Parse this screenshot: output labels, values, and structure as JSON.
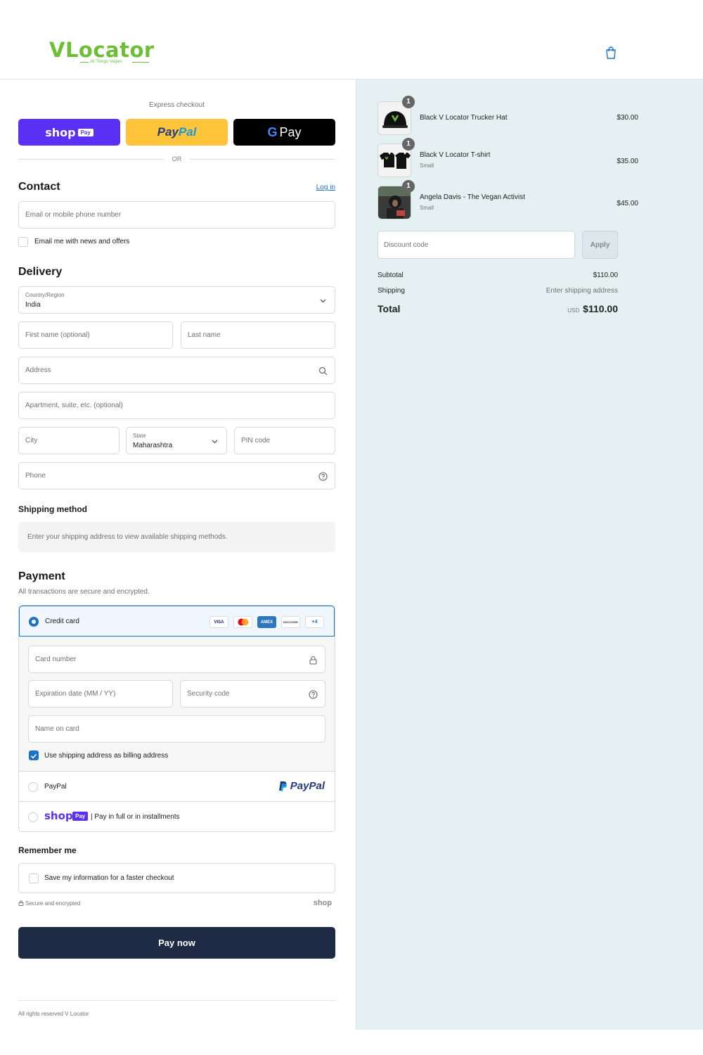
{
  "brand": {
    "name": "VLocator",
    "tagline": "All Things Vegan"
  },
  "express": {
    "title": "Express checkout",
    "shop_pay": {
      "word": "shop",
      "badge": "Pay"
    },
    "paypal": {
      "part1": "Pay",
      "part2": "Pal"
    },
    "gpay": {
      "g": "G",
      "label": "Pay"
    },
    "or": "OR"
  },
  "contact": {
    "heading": "Contact",
    "login_link": "Log in",
    "email_placeholder": "Email or mobile phone number",
    "newsletter_label": "Email me with news and offers"
  },
  "delivery": {
    "heading": "Delivery",
    "country_label": "Country/Region",
    "country_value": "India",
    "first_name_placeholder": "First name (optional)",
    "last_name_placeholder": "Last name",
    "address_placeholder": "Address",
    "apartment_placeholder": "Apartment, suite, etc. (optional)",
    "city_placeholder": "City",
    "state_label": "State",
    "state_value": "Maharashtra",
    "pin_placeholder": "PIN code",
    "phone_placeholder": "Phone"
  },
  "shipping_method": {
    "heading": "Shipping method",
    "message": "Enter your shipping address to view available shipping methods."
  },
  "payment": {
    "heading": "Payment",
    "subtitle": "All transactions are secure and encrypted.",
    "credit_card_label": "Credit card",
    "card_brands": [
      "VISA",
      "",
      "AMEX",
      "DISCOVER",
      "+4"
    ],
    "card_number_placeholder": "Card number",
    "expiry_placeholder": "Expiration date (MM / YY)",
    "security_placeholder": "Security code",
    "name_placeholder": "Name on card",
    "billing_same_label": "Use shipping address as billing address",
    "paypal_label": "PayPal",
    "paypal_logo": "PayPal",
    "shop_pay_word": "shop",
    "shop_pay_badge": "Pay",
    "shop_pay_label": "| Pay in full or in installments"
  },
  "remember": {
    "heading": "Remember me",
    "save_label": "Save my information for a faster checkout",
    "secure_text": "Secure and encrypted",
    "shop_mark": "shop"
  },
  "pay_now_label": "Pay now",
  "footer": "All rights reserved V Locator",
  "cart": {
    "items": [
      {
        "name": "Black V Locator Trucker Hat",
        "variant": "",
        "price": "$30.00",
        "qty": "1"
      },
      {
        "name": "Black V Locator T-shirt",
        "variant": "Small",
        "price": "$35.00",
        "qty": "1"
      },
      {
        "name": "Angela Davis - The Vegan Activist",
        "variant": "Small",
        "price": "$45.00",
        "qty": "1"
      }
    ],
    "discount_placeholder": "Discount code",
    "apply_label": "Apply",
    "subtotal_label": "Subtotal",
    "subtotal_value": "$110.00",
    "shipping_label": "Shipping",
    "shipping_value": "Enter shipping address",
    "total_label": "Total",
    "currency": "USD",
    "total_value": "$110.00"
  },
  "colors": {
    "accent": "#1a73c9",
    "brand_green": "#6cbf35",
    "pay_button": "#1f2a44",
    "summary_bg": "#e4f0f2",
    "shop_pay": "#5a31f4",
    "paypal_yellow": "#ffc439"
  }
}
